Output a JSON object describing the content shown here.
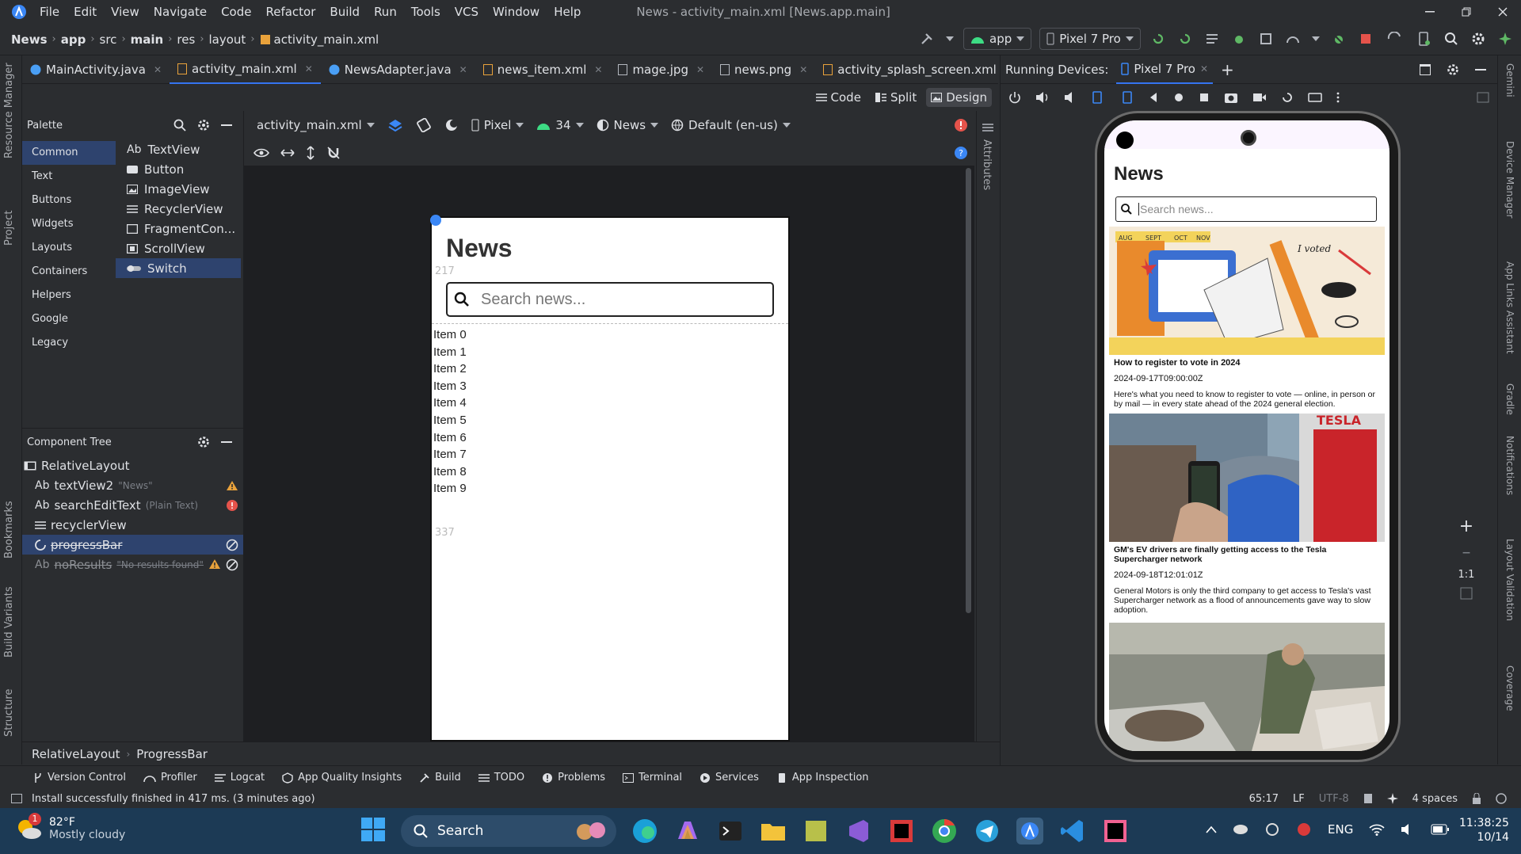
{
  "window": {
    "menu": [
      "File",
      "Edit",
      "View",
      "Navigate",
      "Code",
      "Refactor",
      "Build",
      "Run",
      "Tools",
      "VCS",
      "Window",
      "Help"
    ],
    "title": "News - activity_main.xml [News.app.main]"
  },
  "breadcrumb": [
    "News",
    "app",
    "src",
    "main",
    "res",
    "layout",
    "activity_main.xml"
  ],
  "run_config": {
    "module": "app",
    "device": "Pixel 7 Pro"
  },
  "tabs": [
    {
      "label": "MainActivity.java"
    },
    {
      "label": "activity_main.xml"
    },
    {
      "label": "NewsAdapter.java"
    },
    {
      "label": "news_item.xml"
    },
    {
      "label": "mage.jpg"
    },
    {
      "label": "news.png"
    },
    {
      "label": "activity_splash_screen.xml"
    }
  ],
  "view_modes": {
    "code": "Code",
    "split": "Split",
    "design": "Design"
  },
  "left_strip": {
    "resource_manager": "Resource Manager",
    "project": "Project",
    "bookmarks": "Bookmarks",
    "build_variants": "Build Variants",
    "structure": "Structure"
  },
  "palette": {
    "title": "Palette",
    "categories": [
      "Common",
      "Text",
      "Buttons",
      "Widgets",
      "Layouts",
      "Containers",
      "Helpers",
      "Google",
      "Legacy"
    ],
    "items": [
      "TextView",
      "Button",
      "ImageView",
      "RecyclerView",
      "FragmentCon...",
      "ScrollView",
      "Switch"
    ],
    "textview_prefix": "Ab"
  },
  "component_tree": {
    "title": "Component Tree",
    "root": "RelativeLayout",
    "nodes": [
      {
        "prefix": "Ab",
        "label": "textView2",
        "hint": "\"News\""
      },
      {
        "prefix": "Ab",
        "label": "searchEditText",
        "hint": "(Plain Text)"
      },
      {
        "prefix": "",
        "label": "recyclerView",
        "hint": ""
      },
      {
        "prefix": "",
        "label": "progressBar",
        "hint": ""
      },
      {
        "prefix": "Ab",
        "label": "noResults",
        "hint": "\"No results found\""
      }
    ]
  },
  "editor_toolbar": {
    "file": "activity_main.xml",
    "device": "Pixel",
    "api": "34",
    "theme": "News",
    "locale": "Default (en-us)"
  },
  "design": {
    "title": "News",
    "search_placeholder": "Search news...",
    "dim_top": "217",
    "dim_bottom": "337",
    "items": [
      "Item 0",
      "Item 1",
      "Item 2",
      "Item 3",
      "Item 4",
      "Item 5",
      "Item 6",
      "Item 7",
      "Item 8",
      "Item 9"
    ]
  },
  "attributes_label": "Attributes",
  "running_devices": {
    "label": "Running Devices:",
    "tab": "Pixel 7 Pro"
  },
  "zoom_label": "1:1",
  "phone": {
    "title": "News",
    "search_placeholder": "Search news...",
    "articles": [
      {
        "title": "How to register to vote in 2024",
        "date": "2024-09-17T09:00:00Z",
        "desc": "Here's what you need to know to register to vote — online, in person or by mail — in every state ahead of the 2024 general election.",
        "img_words": [
          "AUG",
          "SEPT",
          "OCT",
          "NOV",
          "I voted"
        ]
      },
      {
        "title": "GM's EV drivers are finally getting access to the Tesla Supercharger network",
        "date": "2024-09-18T12:01:01Z",
        "desc": "General Motors is only the third company to get access to Tesla's vast Supercharger network as a flood of announcements gave way to slow adoption.",
        "img_words": [
          "TESLA"
        ]
      },
      {
        "title": "",
        "date": "",
        "desc": "",
        "img_words": []
      }
    ]
  },
  "right_strip": {
    "gemini": "Gemini",
    "device_manager": "Device Manager",
    "app_links": "App Links Assistant",
    "gradle": "Gradle",
    "notifications": "Notifications",
    "layout_validation": "Layout Validation",
    "coverage": "Coverage"
  },
  "bottom_crumb": [
    "RelativeLayout",
    "ProgressBar"
  ],
  "tool_windows": [
    "Version Control",
    "Profiler",
    "Logcat",
    "App Quality Insights",
    "Build",
    "TODO",
    "Problems",
    "Terminal",
    "Services",
    "App Inspection"
  ],
  "status": {
    "message": "Install successfully finished in 417 ms. (3 minutes ago)",
    "position": "65:17",
    "line_sep": "LF",
    "encoding": "UTF-8",
    "indent": "4 spaces"
  },
  "taskbar": {
    "temp": "82°F",
    "weather": "Mostly cloudy",
    "search": "Search",
    "lang": "ENG",
    "time": "11:38:25",
    "date": "10/14",
    "notif": "1"
  }
}
